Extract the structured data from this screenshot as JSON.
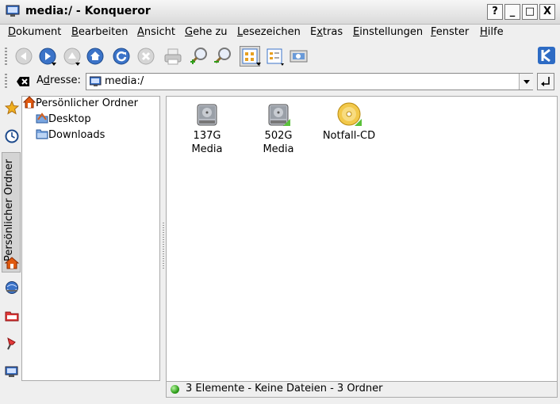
{
  "window": {
    "title": "media:/ - Konqueror"
  },
  "title_buttons": {
    "help": "?",
    "minimize": "_",
    "maximize": "□",
    "close": "X"
  },
  "menu": [
    {
      "label": "Dokument",
      "mnemonic": "D"
    },
    {
      "label": "Bearbeiten",
      "mnemonic": "B"
    },
    {
      "label": "Ansicht",
      "mnemonic": "A"
    },
    {
      "label": "Gehe zu",
      "mnemonic": "G"
    },
    {
      "label": "Lesezeichen",
      "mnemonic": "L"
    },
    {
      "label": "Extras",
      "mnemonic": "x"
    },
    {
      "label": "Einstellungen",
      "mnemonic": "E"
    },
    {
      "label": "Fenster",
      "mnemonic": "F"
    },
    {
      "label": "Hilfe",
      "mnemonic": "H"
    }
  ],
  "location": {
    "label_pre": "A",
    "label_mnemonic": "d",
    "label_post": "resse:",
    "value": "media:/"
  },
  "sidebar": {
    "tab_label": "Persönlicher Ordner",
    "tree": [
      {
        "label": "Persönlicher Ordner",
        "icon": "home-icon"
      },
      {
        "label": "Desktop",
        "icon": "desktop-folder-icon"
      },
      {
        "label": "Downloads",
        "icon": "folder-icon"
      }
    ]
  },
  "view": {
    "items": [
      {
        "line1": "137G",
        "line2": "Media",
        "icon": "hard-disk-icon"
      },
      {
        "line1": "502G",
        "line2": "Media",
        "icon": "mounted-hard-disk-icon"
      },
      {
        "line1": "Notfall-CD",
        "line2": "",
        "icon": "cd-icon"
      }
    ]
  },
  "status": {
    "text": "3 Elemente - Keine Dateien - 3 Ordner"
  },
  "colors": {
    "accent_blue": "#3b73c8",
    "home_orange": "#e05a10"
  }
}
